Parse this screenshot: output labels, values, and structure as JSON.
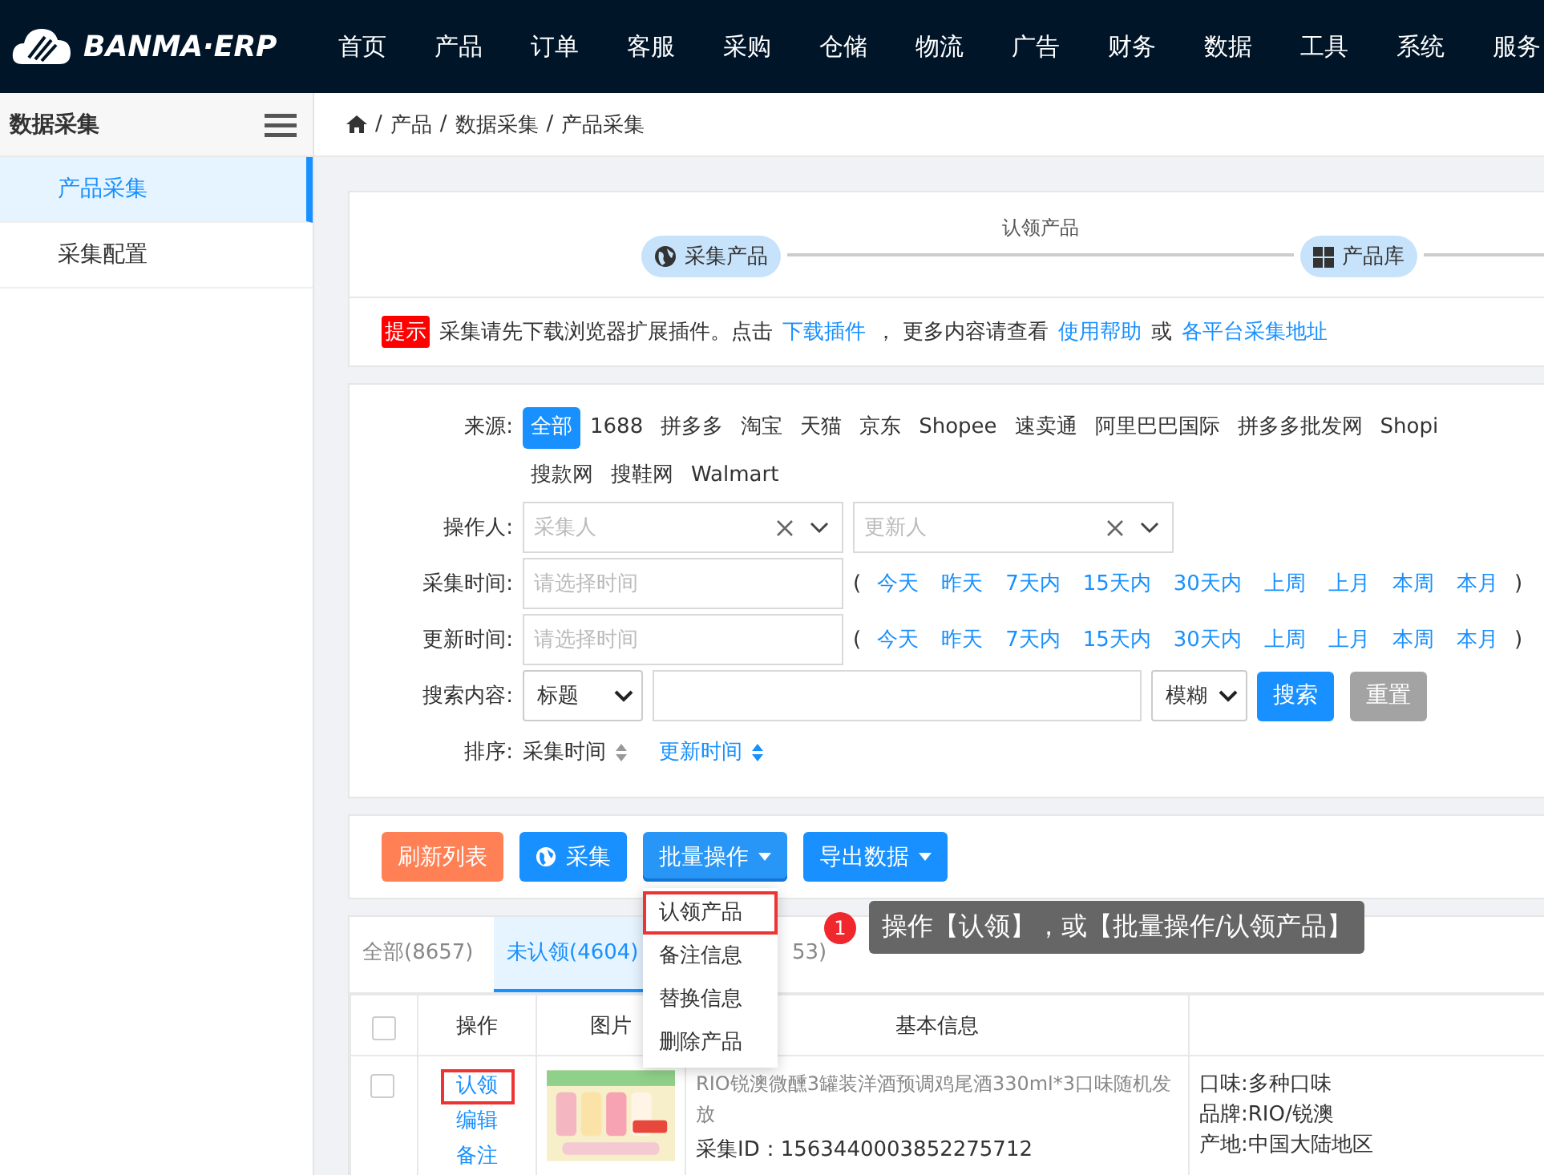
{
  "brand": "BANMA·ERP",
  "nav": [
    "首页",
    "产品",
    "订单",
    "客服",
    "采购",
    "仓储",
    "物流",
    "广告",
    "财务",
    "数据",
    "工具",
    "系统",
    "服务"
  ],
  "sidebar": {
    "title": "数据采集",
    "items": [
      {
        "label": "产品采集",
        "selected": true
      },
      {
        "label": "采集配置",
        "selected": false
      }
    ]
  },
  "breadcrumb": {
    "separator": "/",
    "items": [
      "产品",
      "数据采集",
      "产品采集"
    ]
  },
  "steps": {
    "connector_label": "认领产品",
    "items": [
      {
        "label": "采集产品",
        "kind": "globe"
      },
      {
        "label": "产品库",
        "kind": "grid"
      }
    ]
  },
  "notice": {
    "badge": "提示",
    "parts": [
      {
        "kind": "text",
        "text": "采集请先下载浏览器扩展插件。点击"
      },
      {
        "kind": "link",
        "text": "下载插件"
      },
      {
        "kind": "text",
        "text": "， 更多内容请查看"
      },
      {
        "kind": "link",
        "text": "使用帮助"
      },
      {
        "kind": "text",
        "text": "或"
      },
      {
        "kind": "link",
        "text": "各平台采集地址"
      }
    ]
  },
  "filters": {
    "source": {
      "label": "来源:",
      "rows": [
        [
          {
            "label": "全部",
            "selected": true
          },
          {
            "label": "1688",
            "selected": false
          },
          {
            "label": "拼多多",
            "selected": false
          },
          {
            "label": "淘宝",
            "selected": false
          },
          {
            "label": "天猫",
            "selected": false
          },
          {
            "label": "京东",
            "selected": false
          },
          {
            "label": "Shopee",
            "selected": false
          },
          {
            "label": "速卖通",
            "selected": false
          },
          {
            "label": "阿里巴巴国际",
            "selected": false
          },
          {
            "label": "拼多多批发网",
            "selected": false
          },
          {
            "label": "Shopi",
            "selected": false
          }
        ],
        [
          {
            "label": "搜款网",
            "selected": false
          },
          {
            "label": "搜鞋网",
            "selected": false
          },
          {
            "label": "Walmart",
            "selected": false
          }
        ]
      ]
    },
    "operator": {
      "label": "操作人:",
      "selects": [
        {
          "placeholder": "采集人"
        },
        {
          "placeholder": "更新人"
        }
      ]
    },
    "times": [
      {
        "label": "采集时间:",
        "placeholder": "请选择时间",
        "open": "(",
        "close": ")",
        "quick": [
          "今天",
          "昨天",
          "7天内",
          "15天内",
          "30天内",
          "上周",
          "上月",
          "本周",
          "本月"
        ]
      },
      {
        "label": "更新时间:",
        "placeholder": "请选择时间",
        "open": "(",
        "close": ")",
        "quick": [
          "今天",
          "昨天",
          "7天内",
          "15天内",
          "30天内",
          "上周",
          "上月",
          "本周",
          "本月"
        ]
      }
    ],
    "search": {
      "label": "搜索内容:",
      "field": "标题",
      "mode": "模糊",
      "search_button": "搜索",
      "reset_button": "重置"
    },
    "sort": {
      "label": "排序:",
      "items": [
        {
          "label": "采集时间",
          "selected": false
        },
        {
          "label": "更新时间",
          "selected": true
        }
      ]
    }
  },
  "toolbar": [
    {
      "label": "刷新列表",
      "kind": "refresh"
    },
    {
      "label": "采集",
      "kind": "collect"
    },
    {
      "label": "批量操作",
      "kind": "dropdown",
      "menu_open": true,
      "menu": [
        {
          "label": "认领产品",
          "highlighted": true
        },
        {
          "label": "备注信息",
          "highlighted": false
        },
        {
          "label": "替换信息",
          "highlighted": false
        },
        {
          "label": "删除产品",
          "highlighted": false
        }
      ],
      "callout": {
        "number": "1",
        "text": "操作【认领】，或【批量操作/认领产品】"
      }
    },
    {
      "label": "导出数据",
      "kind": "dropdown",
      "menu_open": false
    }
  ],
  "tabs": [
    {
      "label": "全部(8657)",
      "selected": false
    },
    {
      "label": "未认领(4604)",
      "selected": true
    },
    {
      "label": "53)",
      "selected": false
    }
  ],
  "table": {
    "columns": [
      "操作",
      "图片",
      "基本信息"
    ],
    "all_checked": false,
    "rows": [
      {
        "checked": false,
        "actions": [
          {
            "label": "认领",
            "highlighted": true
          },
          {
            "label": "编辑",
            "highlighted": false
          },
          {
            "label": "备注",
            "highlighted": false
          }
        ],
        "picture": {
          "kind": "picture"
        },
        "title": "RIO锐澳微醺3罐装洋酒预调鸡尾酒330ml*3口味随机发放",
        "id": "采集ID：1563440003852275712",
        "attributes": [
          "口味:多种口味",
          "品牌:RIO/锐澳",
          "产地:中国大陆地区"
        ]
      }
    ]
  }
}
